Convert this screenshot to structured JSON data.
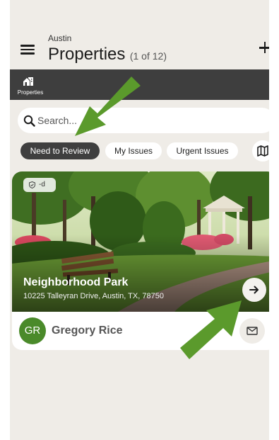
{
  "header": {
    "city": "Austin",
    "title": "Properties",
    "count": "(1 of 12)"
  },
  "nav": {
    "items": [
      {
        "label": "Properties",
        "icon": "properties-icon"
      }
    ]
  },
  "search": {
    "placeholder": "Search..."
  },
  "filters": {
    "chips": [
      {
        "label": "Need to Review",
        "active": true
      },
      {
        "label": "My Issues",
        "active": false
      },
      {
        "label": "Urgent Issues",
        "active": false
      }
    ],
    "map_icon": "map-icon"
  },
  "property_card": {
    "badge": "-d",
    "name": "Neighborhood Park",
    "address": "10225 Talleyran Drive, Austin, TX, 78750",
    "owner_initials": "GR",
    "owner_name": "Gregory Rice"
  },
  "colors": {
    "active_chip": "#3f3f3f",
    "nav_bar": "#3e3e3e",
    "avatar": "#4a8a2a",
    "annotation_arrow": "#5b9a2c",
    "background": "#efece7"
  }
}
